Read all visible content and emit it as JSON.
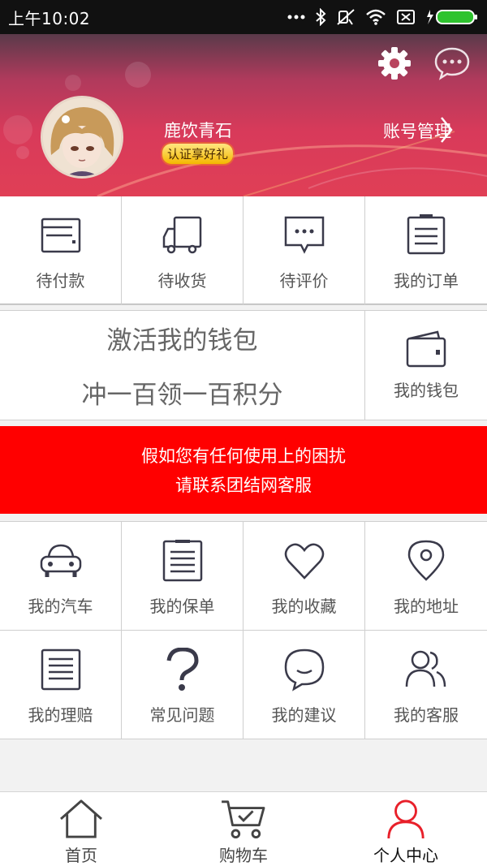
{
  "status_bar": {
    "time": "上午10:02"
  },
  "header": {
    "settings_icon": "gear-icon",
    "message_icon": "chat-bubble-icon",
    "user_name": "鹿饮青石",
    "badge": "认证享好礼",
    "account_link": "账号管理"
  },
  "orders": [
    {
      "label": "待付款",
      "icon": "card-icon"
    },
    {
      "label": "待收货",
      "icon": "truck-icon"
    },
    {
      "label": "待评价",
      "icon": "comment-icon"
    },
    {
      "label": "我的订单",
      "icon": "clipboard-icon"
    }
  ],
  "wallet": {
    "promo_line1": "激活我的钱包",
    "promo_line2": "冲一百领一百积分",
    "label": "我的钱包",
    "icon": "wallet-icon"
  },
  "support": {
    "line1": "假如您有任何使用上的困扰",
    "line2": "请联系团结网客服",
    "color": "#ff0000"
  },
  "services": [
    {
      "label": "我的汽车",
      "icon": "car-icon"
    },
    {
      "label": "我的保单",
      "icon": "document-icon"
    },
    {
      "label": "我的收藏",
      "icon": "heart-icon"
    },
    {
      "label": "我的地址",
      "icon": "location-pin-icon"
    },
    {
      "label": "我的理赔",
      "icon": "list-doc-icon"
    },
    {
      "label": "常见问题",
      "icon": "question-icon"
    },
    {
      "label": "我的建议",
      "icon": "smile-bubble-icon"
    },
    {
      "label": "我的客服",
      "icon": "users-icon"
    }
  ],
  "tabs": [
    {
      "label": "首页",
      "icon": "home-icon"
    },
    {
      "label": "购物车",
      "icon": "cart-icon"
    },
    {
      "label": "个人中心",
      "icon": "person-icon",
      "active": true,
      "color": "#e8202a"
    }
  ]
}
